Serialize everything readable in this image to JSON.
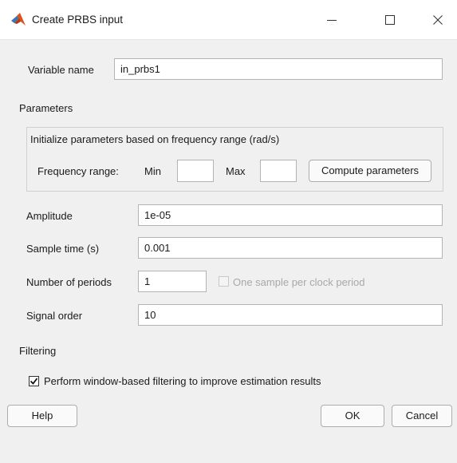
{
  "window": {
    "title": "Create PRBS input",
    "minimize_icon": "minimize-icon",
    "maximize_icon": "maximize-icon",
    "close_icon": "close-icon",
    "app_icon": "matlab-logo-icon"
  },
  "variable": {
    "label": "Variable name",
    "value": "in_prbs1"
  },
  "parameters": {
    "heading": "Parameters",
    "frequency_panel": {
      "title": "Initialize parameters based on frequency range (rad/s)",
      "range_label": "Frequency range:",
      "min_label": "Min",
      "min_value": "",
      "max_label": "Max",
      "max_value": "",
      "compute_button": "Compute parameters"
    },
    "amplitude": {
      "label": "Amplitude",
      "value": "1e-05"
    },
    "sample_time": {
      "label": "Sample time (s)",
      "value": "0.001"
    },
    "num_periods": {
      "label": "Number of periods",
      "value": "1"
    },
    "one_sample_checkbox": {
      "label": "One sample per clock period",
      "checked": false,
      "enabled": false
    },
    "signal_order": {
      "label": "Signal order",
      "value": "10"
    }
  },
  "filtering": {
    "heading": "Filtering",
    "checkbox_label": "Perform window-based filtering to improve estimation results",
    "checked": true
  },
  "buttons": {
    "help": "Help",
    "ok": "OK",
    "cancel": "Cancel"
  },
  "colors": {
    "accent_logo": "#d9541e",
    "field_border": "#b4b4b4",
    "background": "#f0f0f0"
  }
}
